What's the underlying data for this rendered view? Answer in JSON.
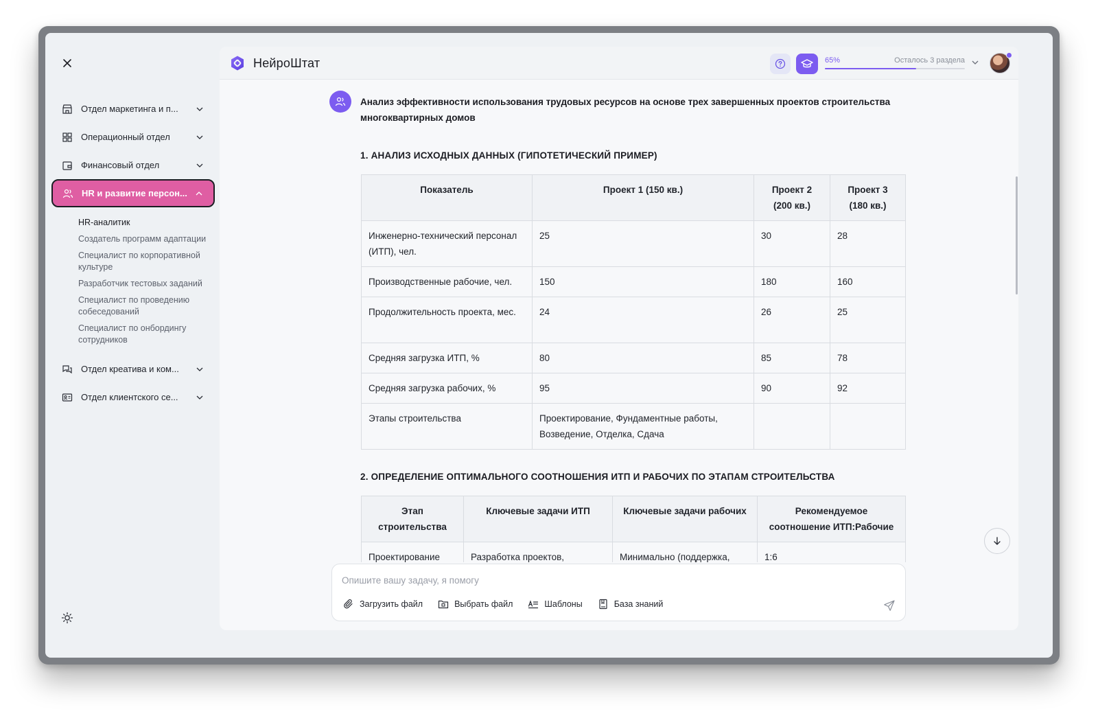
{
  "sidebar": {
    "sections": [
      {
        "label": "Отдел маркетинга и п...",
        "icon": "store-icon"
      },
      {
        "label": "Операционный отдел",
        "icon": "grid-icon"
      },
      {
        "label": "Финансовый отдел",
        "icon": "wallet-icon"
      },
      {
        "label": "HR и развитие персон...",
        "icon": "users-icon",
        "active": true
      },
      {
        "label": "Отдел креатива и ком...",
        "icon": "chat-icon"
      },
      {
        "label": "Отдел клиентского се...",
        "icon": "id-card-icon"
      }
    ],
    "hr_sub_items": [
      "HR-аналитик",
      "Создатель программ адаптации",
      "Специалист по корпоративной культуре",
      "Разработчик тестовых заданий",
      "Специалист по проведению собеседований",
      "Специалист по онбордингу сотрудников"
    ]
  },
  "header": {
    "brand": "НейроШтат",
    "progress_label": "65%",
    "progress_value": 0.65,
    "remaining_label": "Осталось 3 раздела"
  },
  "message": {
    "title": "Анализ эффективности использования трудовых ресурсов на основе трех завершенных проектов строительства многоквартирных домов"
  },
  "section1": {
    "heading": "1. АНАЛИЗ ИСХОДНЫХ ДАННЫХ (ГИПОТЕТИЧЕСКИЙ ПРИМЕР)",
    "columns": [
      "Показатель",
      "Проект 1 (150 кв.)",
      "Проект 2 (200 кв.)",
      "Проект 3 (180 кв.)"
    ],
    "rows": [
      [
        "Инженерно-технический персонал (ИТП), чел.",
        "25",
        "30",
        "28"
      ],
      [
        "Производственные рабочие, чел.",
        "150",
        "180",
        "160"
      ],
      [
        "Продолжительность проекта, мес.",
        "24",
        "26",
        "25"
      ],
      [
        "Средняя загрузка ИТП, %",
        "80",
        "85",
        "78"
      ],
      [
        "Средняя загрузка рабочих, %",
        "95",
        "90",
        "92"
      ],
      [
        "Этапы строительства",
        "Проектирование, Фундаментные работы, Возведение, Отделка, Сдача",
        "",
        ""
      ]
    ]
  },
  "section2": {
    "heading": "2. ОПРЕДЕЛЕНИЕ ОПТИМАЛЬНОГО СООТНОШЕНИЯ ИТП И РАБОЧИХ ПО ЭТАПАМ СТРОИТЕЛЬСТВА",
    "columns": [
      "Этап строительства",
      "Ключевые задачи ИТП",
      "Ключевые задачи рабочих",
      "Рекомендуемое соотношение ИТП:Рабочие"
    ],
    "rows": [
      [
        "Проектирование",
        "Разработка проектов,",
        "Минимально (поддержка,",
        "1:6"
      ]
    ]
  },
  "composer": {
    "placeholder": "Опишите вашу задачу, я помогу",
    "tools": [
      {
        "label": "Загрузить файл",
        "icon": "paperclip-icon"
      },
      {
        "label": "Выбрать файл",
        "icon": "folder-icon"
      },
      {
        "label": "Шаблоны",
        "icon": "templates-icon"
      },
      {
        "label": "База знаний",
        "icon": "book-icon"
      }
    ]
  },
  "colors": {
    "accent": "#7c5cf0",
    "active_section": "#df5ea3"
  }
}
